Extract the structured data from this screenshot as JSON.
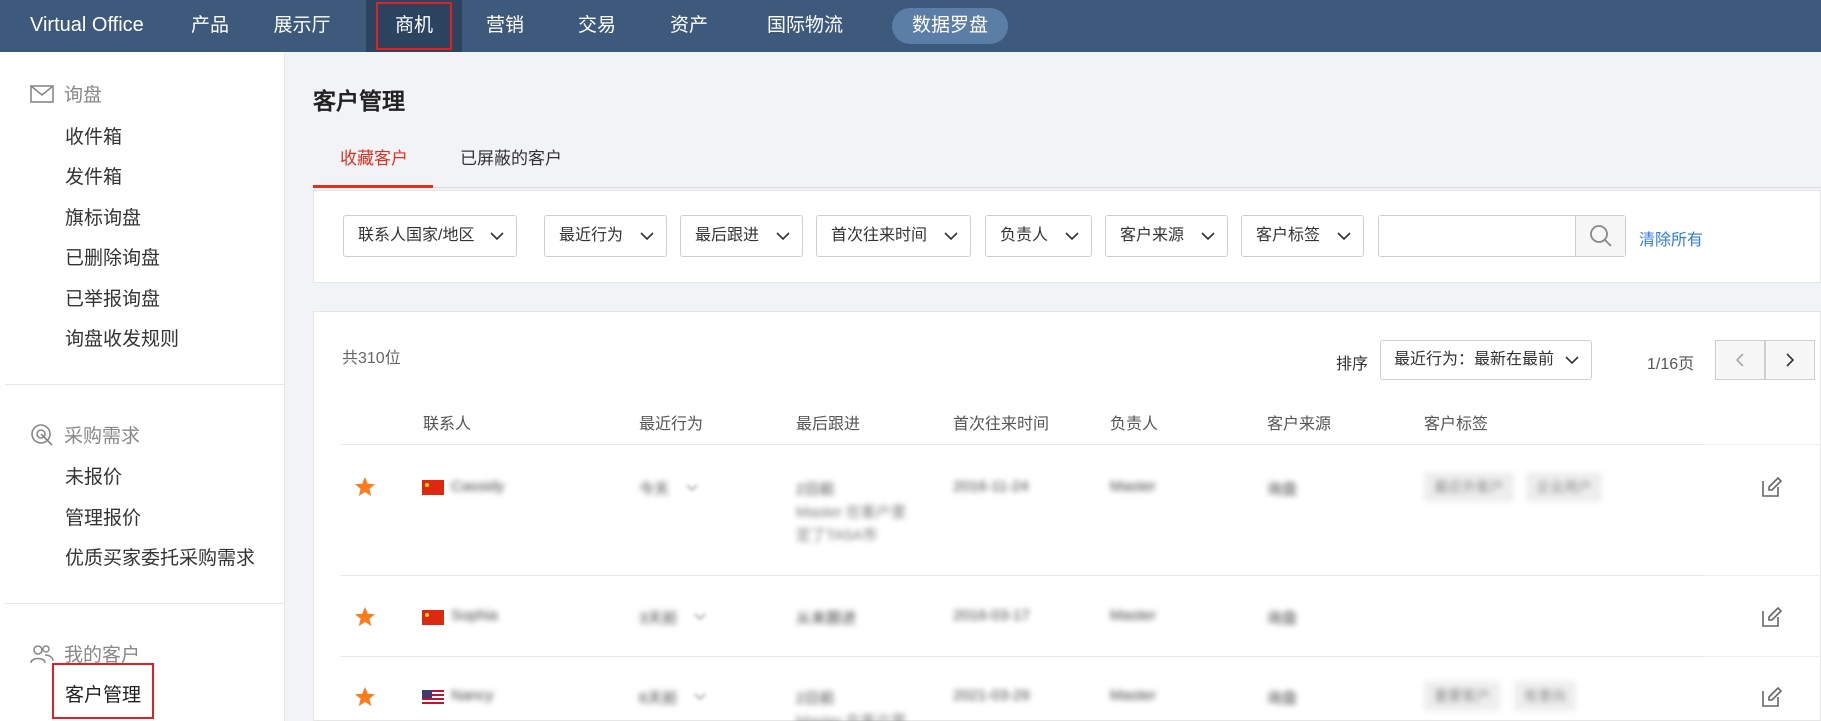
{
  "nav": {
    "brand": "Virtual Office",
    "items": [
      "产品",
      "展示厅",
      "商机",
      "营销",
      "交易",
      "资产",
      "国际物流"
    ],
    "pill": "数据罗盘",
    "accent": "#3d5a7c"
  },
  "sidebar": {
    "groups": [
      {
        "title": "询盘",
        "icon": "mail-icon",
        "items": [
          "收件箱",
          "发件箱",
          "旗标询盘",
          "已删除询盘",
          "已举报询盘",
          "询盘收发规则"
        ]
      },
      {
        "title": "采购需求",
        "icon": "target-icon",
        "items": [
          "未报价",
          "管理报价",
          "优质买家委托采购需求"
        ]
      },
      {
        "title": "我的客户",
        "icon": "users-icon",
        "items": [
          "客户管理"
        ]
      }
    ]
  },
  "page": {
    "title": "客户管理",
    "tabs": [
      "收藏客户",
      "已屏蔽的客户"
    ]
  },
  "filters": {
    "dropdowns": [
      "联系人国家/地区",
      "最近行为",
      "最后跟进",
      "首次往来时间",
      "负责人",
      "客户来源",
      "客户标签"
    ],
    "search_value": "",
    "clear_label": "清除所有"
  },
  "list": {
    "total": "共310位",
    "sort_label": "排序",
    "sort_value": "最近行为：最新在最前",
    "page_info": "1/16页",
    "columns": [
      "联系人",
      "最近行为",
      "最后跟进",
      "首次往来时间",
      "负责人",
      "客户来源",
      "客户标签"
    ],
    "rows": [
      {
        "name": "Cassidy",
        "behavior": "今天",
        "followup": "2日前",
        "followup_line2": "Master 在客户里",
        "followup_line3": "定了TA5A市",
        "first_time": "2016-11-24",
        "owner": "Master",
        "source": "询盘",
        "tags": [
          "最近外客户",
          "企业用户"
        ]
      },
      {
        "name": "Sophia",
        "behavior": "3天前",
        "followup": "从来跟进",
        "first_time": "2016-03-17",
        "owner": "Master",
        "source": "询盘",
        "tags": []
      },
      {
        "name": "Nancy",
        "behavior": "6天前",
        "followup": "2日前",
        "followup_line2": "Master 在客户里",
        "first_time": "2021-03-29",
        "owner": "Master",
        "source": "询盘",
        "tags": [
          "重要客户",
          "有意向"
        ]
      }
    ]
  }
}
